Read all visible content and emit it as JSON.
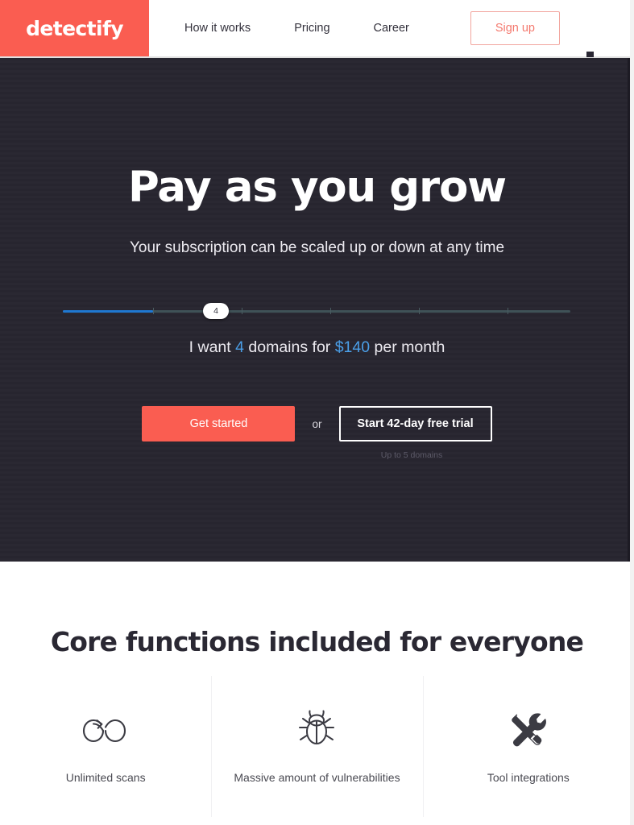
{
  "brand": {
    "logo_text": "detectify",
    "logo_bg": "#fa5d51",
    "coral": "#fa5d51",
    "dark_bg": "#272530",
    "accent_blue": "#4b9fe8"
  },
  "navbar": {
    "links": [
      {
        "label": "How it works"
      },
      {
        "label": "Pricing"
      },
      {
        "label": "Career"
      }
    ],
    "signup_label": "Sign up"
  },
  "hero": {
    "title": "Pay as you grow",
    "subtitle": "Your subscription can be scaled up or down at any time",
    "slider": {
      "value": "4",
      "min": 1,
      "max": 20,
      "fill_percent": 18,
      "handle_percent": 28,
      "track_color": "#3f5257",
      "fill_color": "#1f78d1"
    },
    "price_line": {
      "prefix": "I want ",
      "domains": "4",
      "middle": " domains for ",
      "price": "$140",
      "suffix": " per month"
    },
    "cta": {
      "primary_label": "Get started",
      "or_label": "or",
      "secondary_label": "Start 42-day free trial",
      "trial_note": "Up to 5 domains"
    }
  },
  "features": {
    "title": "Core functions included for everyone",
    "items": [
      {
        "label": "Unlimited scans",
        "icon": "infinity-loop-icon"
      },
      {
        "label": "Massive amount of vulnerabilities",
        "icon": "bug-icon"
      },
      {
        "label": "Tool integrations",
        "icon": "wrench-screwdriver-icon"
      }
    ]
  }
}
